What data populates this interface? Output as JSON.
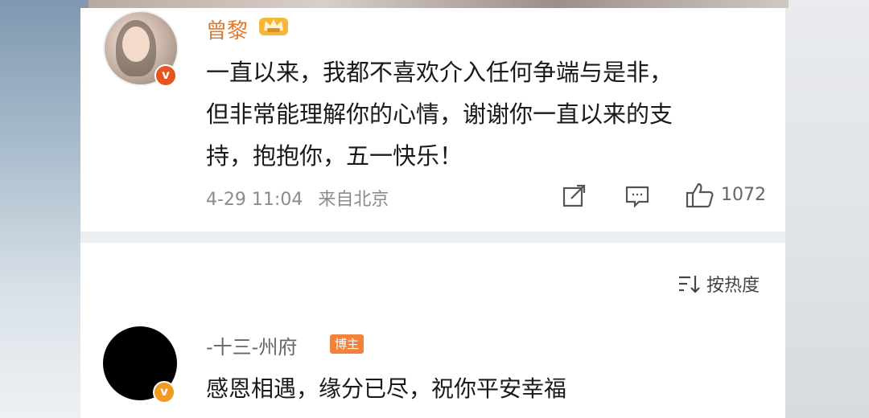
{
  "post": {
    "username": "曾黎",
    "lines": [
      "一直以来，我都不喜欢介入任何争端与是非，",
      "但非常能理解你的心情，谢谢你一直以来的支",
      "持，抱抱你，五一快乐！"
    ],
    "date": "4-29 11:04",
    "source": "来自北京",
    "like_count": "1072",
    "icons": [
      "share-icon",
      "comment-icon",
      "like-icon"
    ]
  },
  "sort": {
    "label": "按热度",
    "icon": "sort-icon"
  },
  "reply": {
    "username": "-十三-州府",
    "badge": "博主",
    "text": "感恩相遇，缘分已尽，祝你平安幸福"
  },
  "colors": {
    "username": "#e07a2c",
    "verified": "#f09a22",
    "blogger_badge": "#f2813b"
  }
}
